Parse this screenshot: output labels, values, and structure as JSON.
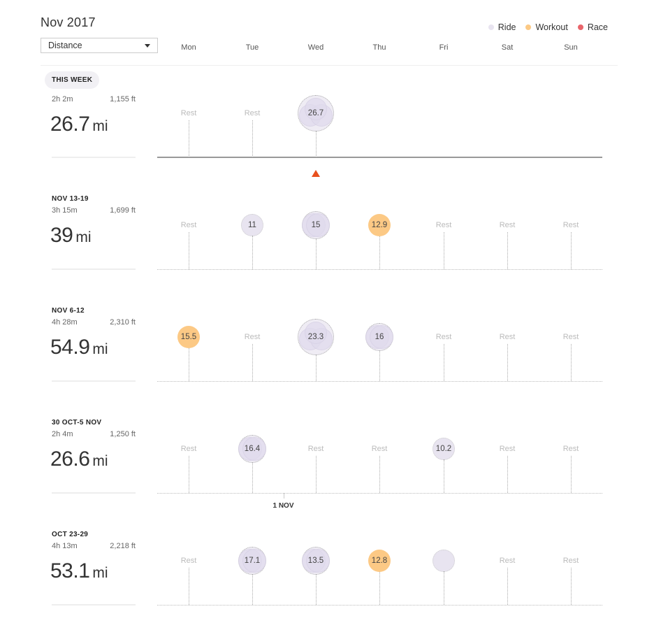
{
  "header": {
    "title": "Nov 2017",
    "metric_select": {
      "selected": "Distance"
    },
    "legend": [
      {
        "label": "Ride",
        "color": "#e8e4f0"
      },
      {
        "label": "Workout",
        "color": "#fcc985"
      },
      {
        "label": "Race",
        "color": "#e9656b"
      }
    ],
    "days": [
      "Mon",
      "Tue",
      "Wed",
      "Thu",
      "Fri",
      "Sat",
      "Sun"
    ]
  },
  "rest_label": "Rest",
  "weeks": [
    {
      "label": "THIS WEEK",
      "current": true,
      "time": "2h 2m",
      "elevation": "1,155 ft",
      "distance": "26.7",
      "unit": "mi",
      "days": [
        {
          "type": "rest"
        },
        {
          "type": "rest"
        },
        {
          "type": "ride",
          "value": "26.7",
          "activities": 3
        },
        {
          "type": "none"
        },
        {
          "type": "none"
        },
        {
          "type": "none"
        },
        {
          "type": "none"
        }
      ]
    },
    {
      "label": "NOV 13-19",
      "time": "3h 15m",
      "elevation": "1,699 ft",
      "distance": "39",
      "unit": "mi",
      "days": [
        {
          "type": "rest"
        },
        {
          "type": "ride",
          "value": "11",
          "activities": 1
        },
        {
          "type": "ride",
          "value": "15",
          "activities": 2
        },
        {
          "type": "workout",
          "value": "12.9",
          "activities": 1
        },
        {
          "type": "rest"
        },
        {
          "type": "rest"
        },
        {
          "type": "rest"
        }
      ]
    },
    {
      "label": "NOV 6-12",
      "time": "4h 28m",
      "elevation": "2,310 ft",
      "distance": "54.9",
      "unit": "mi",
      "days": [
        {
          "type": "workout",
          "value": "15.5",
          "activities": 1
        },
        {
          "type": "rest"
        },
        {
          "type": "ride",
          "value": "23.3",
          "activities": 3
        },
        {
          "type": "ride",
          "value": "16",
          "activities": 2
        },
        {
          "type": "rest"
        },
        {
          "type": "rest"
        },
        {
          "type": "rest"
        }
      ]
    },
    {
      "label": "30 OCT-5 NOV",
      "time": "2h 4m",
      "elevation": "1,250 ft",
      "distance": "26.6",
      "unit": "mi",
      "month_marker": "1 NOV",
      "days": [
        {
          "type": "rest"
        },
        {
          "type": "ride",
          "value": "16.4",
          "activities": 2
        },
        {
          "type": "rest"
        },
        {
          "type": "rest"
        },
        {
          "type": "ride",
          "value": "10.2",
          "activities": 1
        },
        {
          "type": "rest"
        },
        {
          "type": "rest"
        }
      ]
    },
    {
      "label": "OCT 23-29",
      "time": "4h 13m",
      "elevation": "2,218 ft",
      "distance": "53.1",
      "unit": "mi",
      "days": [
        {
          "type": "rest"
        },
        {
          "type": "ride",
          "value": "17.1",
          "activities": 2
        },
        {
          "type": "ride",
          "value": "13.5",
          "activities": 2
        },
        {
          "type": "workout",
          "value": "12.8",
          "activities": 1
        },
        {
          "type": "ride",
          "value": "",
          "activities": 1
        },
        {
          "type": "rest"
        },
        {
          "type": "rest"
        }
      ]
    }
  ]
}
